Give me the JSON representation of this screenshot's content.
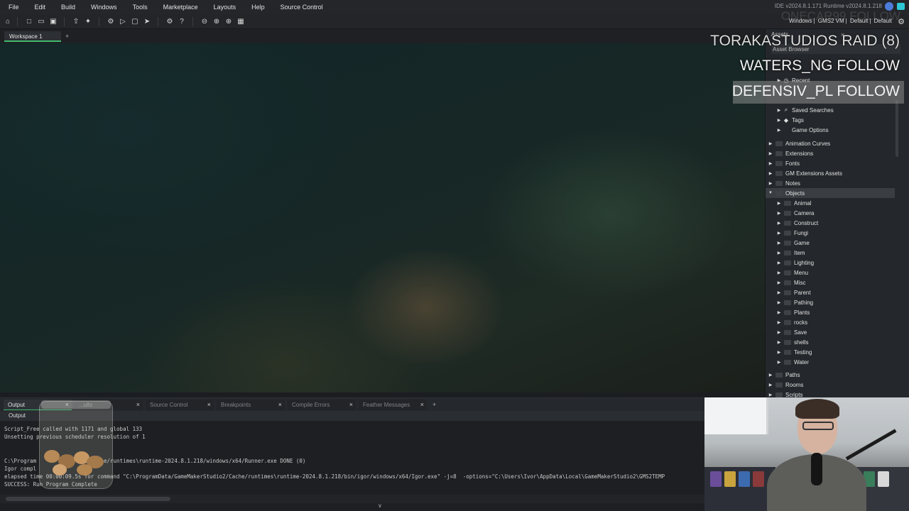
{
  "menubar": {
    "items": [
      "File",
      "Edit",
      "Build",
      "Windows",
      "Tools",
      "Marketplace",
      "Layouts",
      "Help",
      "Source Control"
    ],
    "version_text": "IDE v2024.8.1.171  Runtime v2024.8.1.218"
  },
  "toolbar": {
    "target": {
      "platform": "Windows",
      "runtime": "GMS2 VM",
      "config_a": "Default",
      "config_b": "Default"
    }
  },
  "workspace": {
    "tab_label": "Workspace 1",
    "add_label": "+"
  },
  "assets": {
    "header": "Assets",
    "browser_label": "Asset Browser",
    "items": [
      {
        "label": "Recent",
        "level": 1,
        "expanded": false,
        "icon": "clock-icon"
      },
      {
        "label": "Saved Searches",
        "level": 1,
        "expanded": false,
        "icon": "search-icon"
      },
      {
        "label": "Tags",
        "level": 1,
        "expanded": false,
        "icon": "tag-icon"
      },
      {
        "label": "Game Options",
        "level": 1,
        "expanded": false,
        "icon": ""
      },
      {
        "label": "Animation Curves",
        "level": 0,
        "expanded": false,
        "icon": "folder-icon"
      },
      {
        "label": "Extensions",
        "level": 0,
        "expanded": false,
        "icon": "folder-icon"
      },
      {
        "label": "Fonts",
        "level": 0,
        "expanded": false,
        "icon": "folder-icon"
      },
      {
        "label": "GM Extensions Assets",
        "level": 0,
        "expanded": false,
        "icon": "folder-icon"
      },
      {
        "label": "Notes",
        "level": 0,
        "expanded": false,
        "icon": "folder-icon"
      },
      {
        "label": "Objects",
        "level": 0,
        "expanded": true,
        "icon": "folder-icon",
        "selected": true
      },
      {
        "label": "Animal",
        "level": 1,
        "expanded": false,
        "icon": "folder-icon"
      },
      {
        "label": "Camera",
        "level": 1,
        "expanded": false,
        "icon": "folder-icon"
      },
      {
        "label": "Construct",
        "level": 1,
        "expanded": false,
        "icon": "folder-icon"
      },
      {
        "label": "Fungi",
        "level": 1,
        "expanded": false,
        "icon": "folder-icon"
      },
      {
        "label": "Game",
        "level": 1,
        "expanded": false,
        "icon": "folder-icon"
      },
      {
        "label": "Item",
        "level": 1,
        "expanded": false,
        "icon": "folder-icon"
      },
      {
        "label": "Lighting",
        "level": 1,
        "expanded": false,
        "icon": "folder-icon"
      },
      {
        "label": "Menu",
        "level": 1,
        "expanded": false,
        "icon": "folder-icon"
      },
      {
        "label": "Misc",
        "level": 1,
        "expanded": false,
        "icon": "folder-icon"
      },
      {
        "label": "Parent",
        "level": 1,
        "expanded": false,
        "icon": "folder-icon"
      },
      {
        "label": "Pathing",
        "level": 1,
        "expanded": false,
        "icon": "folder-icon"
      },
      {
        "label": "Plants",
        "level": 1,
        "expanded": false,
        "icon": "folder-icon"
      },
      {
        "label": "rocks",
        "level": 1,
        "expanded": false,
        "icon": "folder-icon"
      },
      {
        "label": "Save",
        "level": 1,
        "expanded": false,
        "icon": "folder-icon"
      },
      {
        "label": "shells",
        "level": 1,
        "expanded": false,
        "icon": "folder-icon"
      },
      {
        "label": "Testing",
        "level": 1,
        "expanded": false,
        "icon": "folder-icon"
      },
      {
        "label": "Water",
        "level": 1,
        "expanded": false,
        "icon": "folder-icon"
      },
      {
        "label": "Paths",
        "level": 0,
        "expanded": false,
        "icon": "folder-icon"
      },
      {
        "label": "Rooms",
        "level": 0,
        "expanded": false,
        "icon": "folder-icon"
      },
      {
        "label": "Scripts",
        "level": 0,
        "expanded": false,
        "icon": "folder-icon"
      }
    ]
  },
  "output": {
    "tabs": [
      {
        "label": "Output",
        "active": true
      },
      {
        "label": "...ults",
        "active": false
      },
      {
        "label": "Source Control",
        "active": false
      },
      {
        "label": "Breakpoints",
        "active": false
      },
      {
        "label": "Compile Errors",
        "active": false
      },
      {
        "label": "Feather Messages",
        "active": false
      }
    ],
    "add_label": "+",
    "sub_label": "Output",
    "lines": [
      "Script_Free called with 1171 and global 133",
      "Unsetting previous scheduler resolution of 1",
      "",
      "",
      "C:\\Program                 Cache/runtimes\\runtime-2024.8.1.218/windows/x64/Runner.exe DONE (0)",
      "Igor compl",
      "elapsed time 00:00:09.5s for command \"C:\\ProgramData/GameMakerStudio2/Cache/runtimes\\runtime-2024.8.1.218/bin/igor/windows/x64/Igor.exe\" -j=8  -options=\"C:\\Users\\Ivor\\AppData\\Local\\GameMakerStudio2\\GMS2TEMP",
      "SUCCESS: Run Program Complete"
    ]
  },
  "overlay": {
    "ghost_text": "ONECAR99  FOLLOW",
    "line1": "TORAKASTUDIOS  RAID (8)",
    "line2": "WATERS_NG  FOLLOW",
    "line3": "DEFENSIV_PL  FOLLOW"
  },
  "colors": {
    "accent_green": "#3fb96e",
    "panel_bg": "#24272b",
    "user_icon": "#4d7bd8",
    "chat_icon": "#2ec7d6"
  }
}
